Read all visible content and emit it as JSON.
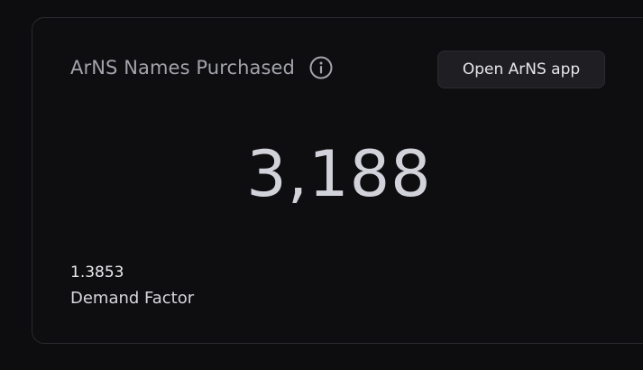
{
  "card": {
    "title": "ArNS Names Purchased",
    "info_icon": "info-circle-icon",
    "open_button_label": "Open ArNS app",
    "count": "3,188",
    "demand_factor": {
      "value": "1.3853",
      "label": "Demand Factor"
    }
  },
  "colors": {
    "background": "#0d0d0f",
    "card_border": "#2a2a2f",
    "muted_text": "#a3a3ab",
    "button_bg": "#1f1f23"
  }
}
